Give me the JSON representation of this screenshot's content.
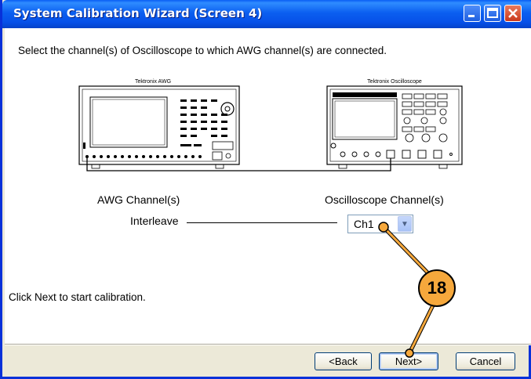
{
  "window": {
    "title": "System Calibration Wizard (Screen 4)",
    "title_icons": [
      "minimize-icon",
      "maximize-icon",
      "close-icon"
    ]
  },
  "main": {
    "instruction": "Select the channel(s) of Oscilloscope to which AWG channel(s) are connected.",
    "diagram": {
      "awg_label": "Tektronix AWG",
      "scope_label": "Tektronix Oscilloscope"
    },
    "awg_header": "AWG Channel(s)",
    "scope_header": "Oscilloscope Channel(s)",
    "awg_channel": "Interleave",
    "scope_channel_selected": "Ch1",
    "footer_note": "Click Next to start calibration."
  },
  "buttons": {
    "back": "<Back",
    "next": "Next>",
    "cancel": "Cancel"
  },
  "callout": {
    "number": "18",
    "color": "#f6a83c"
  }
}
